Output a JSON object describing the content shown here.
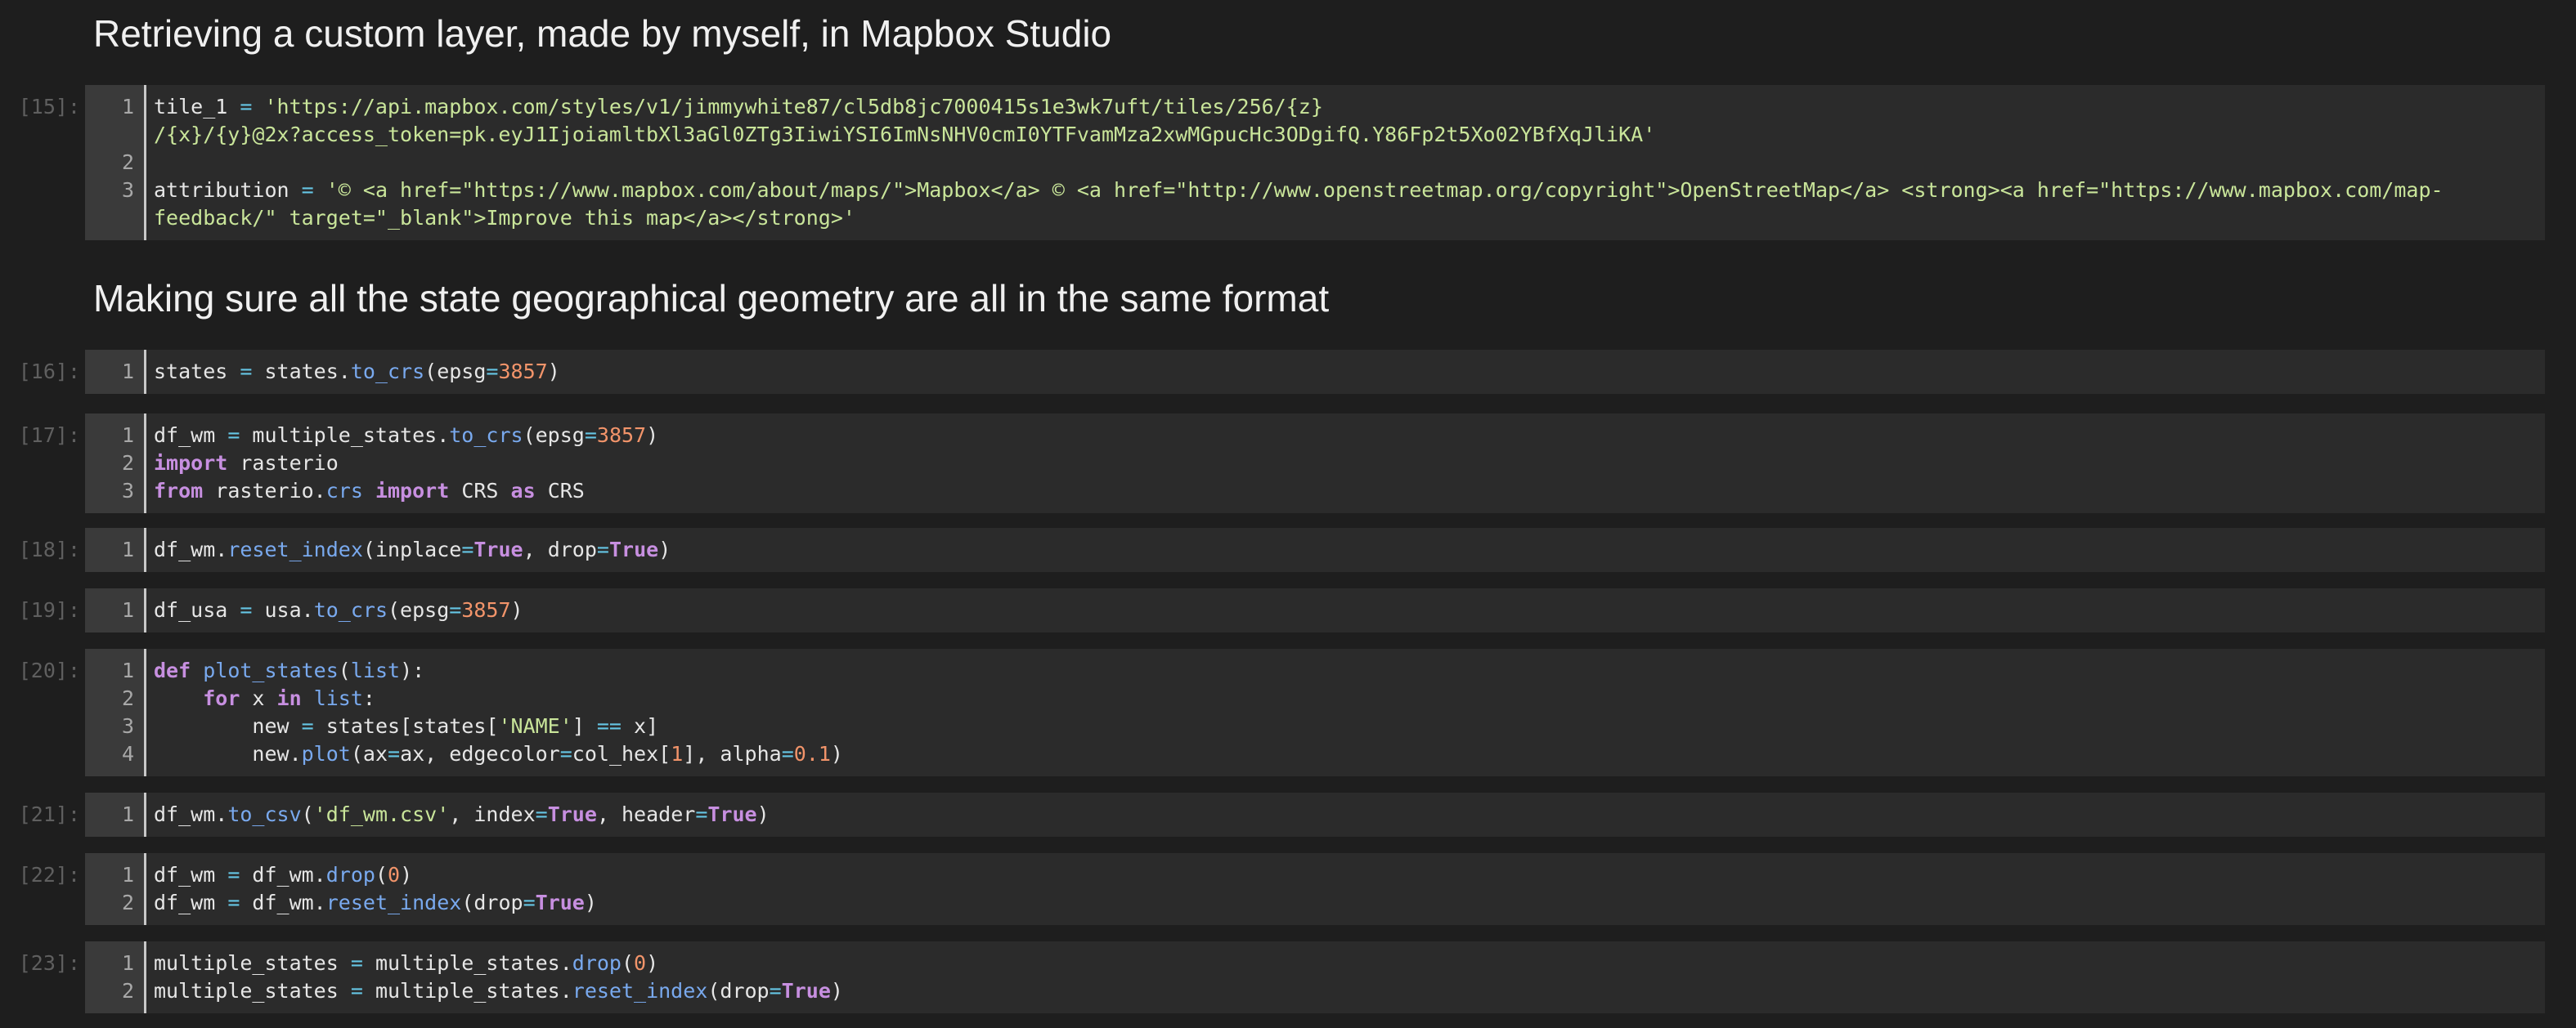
{
  "headings": [
    "Retrieving a custom layer, made by myself, in Mapbox Studio",
    "Making sure all the state geographical geometry are all in the same format"
  ],
  "cells": [
    {
      "prompt": "[15]:",
      "line_numbers": [
        "1",
        "2",
        "3"
      ],
      "lines": [
        [
          "tile_1 ",
          "= ",
          "'https://api.mapbox.com/styles/v1/jimmywhite87/cl5db8jc7000415s1e3wk7uft/tiles/256/{z}"
        ],
        [
          "/{x}/{y}@2x?access_token=pk.eyJ1IjoiamltbXl3aGl0ZTg3IiwiYSI6ImNsNHV0cmI0YTFvamMza2xwMGpucHc3ODgifQ.Y86Fp2t5Xo02YBfXqJliKA'"
        ],
        [
          ""
        ],
        [
          "attribution ",
          "= ",
          "'© <a href=\"https://www.mapbox.com/about/maps/\">Mapbox</a> © <a href=\"http://www.openstreetmap.org/copyright\">OpenStreetMap</a> <strong><a href=\"https://www.mapbox.com/map-"
        ],
        [
          "feedback/\" target=\"_blank\">Improve this map</a></strong>'"
        ]
      ]
    },
    {
      "prompt": "[16]:",
      "line_numbers": [
        "1"
      ],
      "lines": [
        [
          "states ",
          "= ",
          "states.",
          "to_crs",
          "(epsg",
          "=",
          "3857",
          ")"
        ]
      ]
    },
    {
      "prompt": "[17]:",
      "line_numbers": [
        "1",
        "2",
        "3"
      ],
      "lines": [
        [
          "df_wm ",
          "= ",
          "multiple_states.",
          "to_crs",
          "(epsg",
          "=",
          "3857",
          ")"
        ],
        [
          "import",
          " rasterio"
        ],
        [
          "from",
          " rasterio.",
          "crs",
          " ",
          "import",
          " CRS ",
          "as",
          " CRS"
        ]
      ]
    },
    {
      "prompt": "[18]:",
      "line_numbers": [
        "1"
      ],
      "lines": [
        [
          "df_wm.",
          "reset_index",
          "(inplace",
          "=",
          "True",
          ", drop",
          "=",
          "True",
          ")"
        ]
      ]
    },
    {
      "prompt": "[19]:",
      "line_numbers": [
        "1"
      ],
      "lines": [
        [
          "df_usa ",
          "= ",
          "usa.",
          "to_crs",
          "(epsg",
          "=",
          "3857",
          ")"
        ]
      ]
    },
    {
      "prompt": "[20]:",
      "line_numbers": [
        "1",
        "2",
        "3",
        "4"
      ],
      "lines": [
        [
          "def",
          " ",
          "plot_states",
          "(",
          "list",
          "):"
        ],
        [
          "    ",
          "for",
          " x ",
          "in",
          " ",
          "list",
          ":"
        ],
        [
          "        new ",
          "= ",
          "states[states[",
          "'NAME'",
          "] ",
          "==",
          " x]"
        ],
        [
          "        new.",
          "plot",
          "(ax",
          "=",
          "ax, edgecolor",
          "=",
          "col_hex[",
          "1",
          "], alpha",
          "=",
          "0.1",
          ")"
        ]
      ]
    },
    {
      "prompt": "[21]:",
      "line_numbers": [
        "1"
      ],
      "lines": [
        [
          "df_wm.",
          "to_csv",
          "(",
          "'df_wm.csv'",
          ", index",
          "=",
          "True",
          ", header",
          "=",
          "True",
          ")"
        ]
      ]
    },
    {
      "prompt": "[22]:",
      "line_numbers": [
        "1",
        "2"
      ],
      "lines": [
        [
          "df_wm ",
          "= ",
          "df_wm.",
          "drop",
          "(",
          "0",
          ")"
        ],
        [
          "df_wm ",
          "= ",
          "df_wm.",
          "reset_index",
          "(drop",
          "=",
          "True",
          ")"
        ]
      ]
    },
    {
      "prompt": "[23]:",
      "line_numbers": [
        "1",
        "2"
      ],
      "lines": [
        [
          "multiple_states ",
          "= ",
          "multiple_states.",
          "drop",
          "(",
          "0",
          ")"
        ],
        [
          "multiple_states ",
          "= ",
          "multiple_states.",
          "reset_index",
          "(drop",
          "=",
          "True",
          ")"
        ]
      ]
    }
  ],
  "colors": {
    "background": "#1e1e1e",
    "cell_background": "#2b2b2b",
    "gutter": "#3a3a3a",
    "keyword": "#c78fe0",
    "string": "#c9e59a",
    "number": "#f2946a",
    "function": "#79a9ee",
    "operator": "#66c6e4",
    "text": "#e6e6e6",
    "prompt": "#5f5f5f"
  }
}
